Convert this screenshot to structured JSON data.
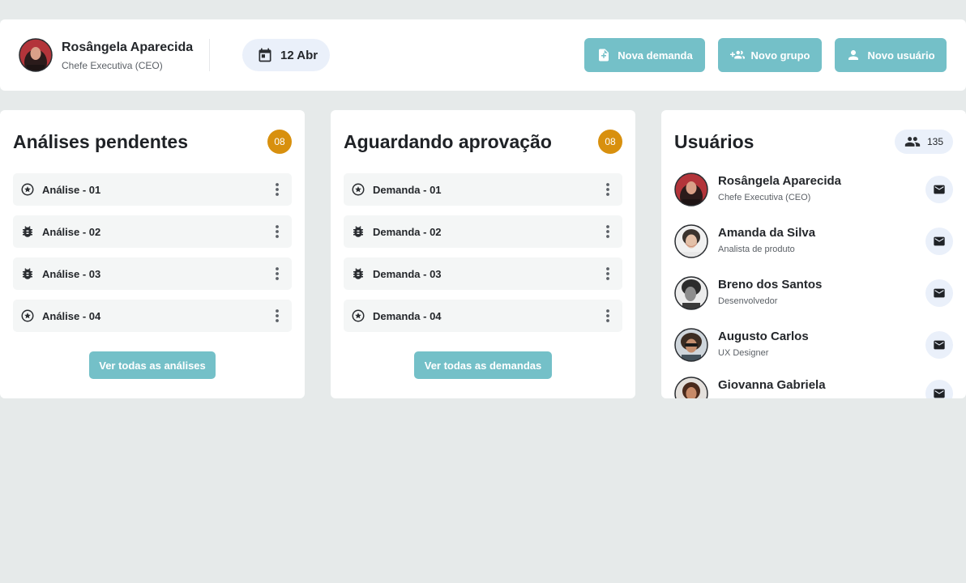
{
  "header": {
    "user": {
      "name": "Rosângela Aparecida",
      "role": "Chefe Executiva (CEO)"
    },
    "date": {
      "icon": "calendar-icon",
      "label": "12 Abr"
    },
    "actions": [
      {
        "icon": "file-plus-icon",
        "label": "Nova demanda"
      },
      {
        "icon": "group-add-icon",
        "label": "Novo grupo"
      },
      {
        "icon": "person-icon",
        "label": "Novo usuário"
      }
    ]
  },
  "analises": {
    "title": "Análises pendentes",
    "count": "08",
    "items": [
      {
        "icon": "star-circle-icon",
        "label": "Análise - 01"
      },
      {
        "icon": "bug-icon",
        "label": "Análise - 02"
      },
      {
        "icon": "bug-icon",
        "label": "Análise - 03"
      },
      {
        "icon": "star-circle-icon",
        "label": "Análise - 04"
      }
    ],
    "see_all": "Ver todas as análises"
  },
  "aprovacao": {
    "title": "Aguardando aprovação",
    "count": "08",
    "items": [
      {
        "icon": "star-circle-icon",
        "label": "Demanda - 01"
      },
      {
        "icon": "bug-icon",
        "label": "Demanda - 02"
      },
      {
        "icon": "bug-icon",
        "label": "Demanda - 03"
      },
      {
        "icon": "star-circle-icon",
        "label": "Demanda - 04"
      }
    ],
    "see_all": "Ver todas as demandas"
  },
  "usuarios": {
    "title": "Usuários",
    "count": "135",
    "items": [
      {
        "name": "Rosângela Aparecida",
        "role": "Chefe Executiva (CEO)"
      },
      {
        "name": "Amanda da Silva",
        "role": "Analista de produto"
      },
      {
        "name": "Breno dos Santos",
        "role": "Desenvolvedor"
      },
      {
        "name": "Augusto Carlos",
        "role": "UX Designer"
      },
      {
        "name": "Giovanna Gabriela",
        "role": ""
      }
    ]
  },
  "colors": {
    "background": "#e6eaea",
    "accent": "#74c0c8",
    "badge": "#d8900e",
    "pill": "#eaf0fa"
  }
}
